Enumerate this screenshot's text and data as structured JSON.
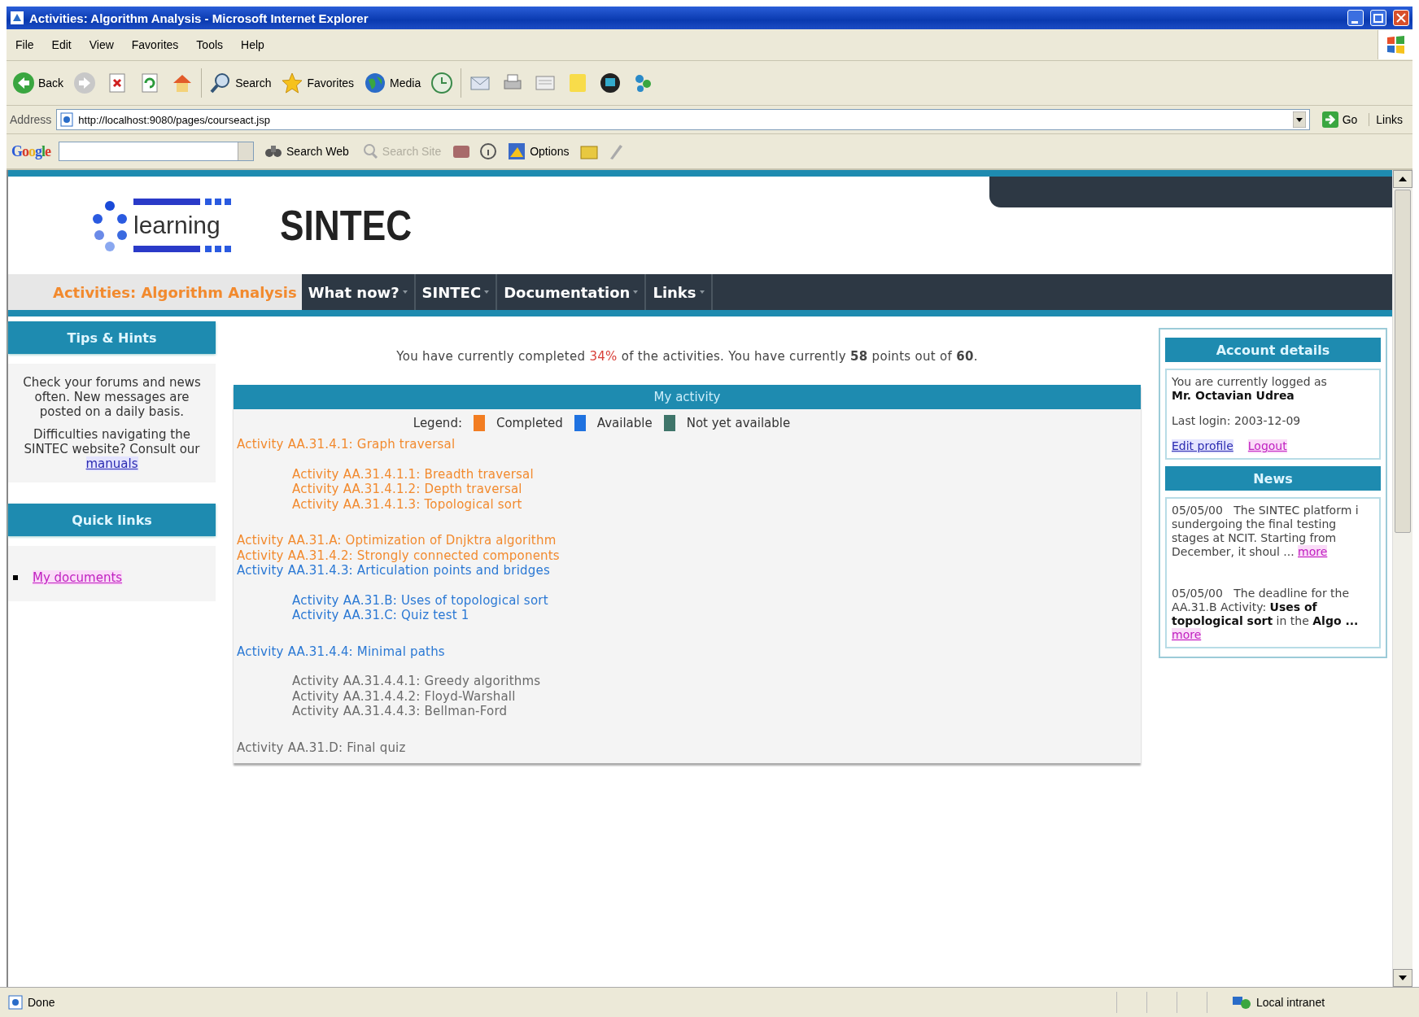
{
  "window": {
    "title": "Activities: Algorithm Analysis - Microsoft Internet Explorer"
  },
  "menu": [
    "File",
    "Edit",
    "View",
    "Favorites",
    "Tools",
    "Help"
  ],
  "toolbar": [
    {
      "kind": "back",
      "label": "Back"
    },
    {
      "kind": "forward"
    },
    {
      "kind": "stop"
    },
    {
      "kind": "refresh"
    },
    {
      "kind": "home"
    },
    {
      "kind": "search",
      "label": "Search"
    },
    {
      "kind": "favorites",
      "label": "Favorites"
    },
    {
      "kind": "media",
      "label": "Media"
    },
    {
      "kind": "history"
    },
    {
      "kind": "mail"
    },
    {
      "kind": "print"
    },
    {
      "kind": "edit"
    },
    {
      "kind": "note"
    },
    {
      "kind": "messenger"
    },
    {
      "kind": "people"
    }
  ],
  "address": {
    "label": "Address",
    "value": "http://localhost:9080/pages/courseact.jsp",
    "go": "Go",
    "links": "Links"
  },
  "google_bar": {
    "logo": "Google",
    "search_web": "Search Web",
    "search_site": "Search Site",
    "options": "Options"
  },
  "site": {
    "logo_text": "learning",
    "title": "SINTEC"
  },
  "nav": {
    "page_title": "Activities: Algorithm Analysis",
    "items": [
      "What now?",
      "SINTEC",
      "Documentation",
      "Links"
    ]
  },
  "tips": {
    "title": "Tips & Hints",
    "paragraphs": [
      {
        "text": "Check your forums and news often. New messages are posted on a daily basis."
      },
      {
        "text": "Difficulties navigating the SINTEC website? Consult our ",
        "link": "manuals"
      }
    ]
  },
  "quick_links": {
    "title": "Quick links",
    "items": [
      {
        "label": "My documents",
        "visited": true
      }
    ]
  },
  "summary": {
    "before": "You have currently completed ",
    "percent": "34%",
    "after": " of the activities. You have currently **58** points out of **60**."
  },
  "activity": {
    "title": "My activity",
    "legend_label": "Legend:",
    "legend": [
      {
        "label": "Completed",
        "color": "#f27d22"
      },
      {
        "label": "Available",
        "color": "#1f72e0"
      },
      {
        "label": "Not yet available",
        "color": "#3f756a"
      }
    ],
    "items": [
      {
        "label": "Activity AA.31.4.1: Graph traversal",
        "color": "#f28a2e",
        "children": [
          {
            "label": "Activity AA.31.4.1.1: Breadth traversal",
            "color": "#f28a2e"
          },
          {
            "label": "Activity AA.31.4.1.2: Depth traversal",
            "color": "#f28a2e"
          },
          {
            "label": "Activity AA.31.4.1.3: Topological sort",
            "color": "#f28a2e"
          }
        ]
      },
      {
        "label": "Activity AA.31.A: Optimization of Dnjktra algorithm",
        "color": "#f28a2e"
      },
      {
        "label": "Activity AA.31.4.2: Strongly connected components",
        "color": "#f28a2e"
      },
      {
        "label": "Activity AA.31.4.3: Articulation points and bridges",
        "color": "#2a78d4",
        "children": [
          {
            "label": "Activity AA.31.B: Uses of topological sort",
            "color": "#2a78d4"
          },
          {
            "label": "Activity AA.31.C: Quiz test 1",
            "color": "#2a78d4"
          }
        ]
      },
      {
        "label": "Activity AA.31.4.4: Minimal paths",
        "color": "#2a78d4",
        "children": [
          {
            "label": "Activity AA.31.4.4.1: Greedy algorithms",
            "color": "#6a6a6a"
          },
          {
            "label": "Activity AA.31.4.4.2: Floyd-Warshall",
            "color": "#6a6a6a"
          },
          {
            "label": "Activity AA.31.4.4.3: Bellman-Ford",
            "color": "#6a6a6a"
          }
        ]
      },
      {
        "label": "Activity AA.31.D: Final quiz",
        "color": "#6a6a6a"
      }
    ]
  },
  "account": {
    "title": "Account details",
    "logged_as": "You are currently logged as",
    "user": "Mr. Octavian Udrea",
    "last_login": "Last login: 2003-12-09",
    "links": [
      {
        "label": "Edit profile",
        "visited": false
      },
      {
        "label": "Logout",
        "visited": true
      }
    ]
  },
  "news": {
    "title": "News",
    "items": [
      {
        "date": "05/05/00",
        "text": "The SINTEC platform i sundergoing the final testing stages at NCIT. Starting from December, it shoul ...",
        "more": {
          "label": "more",
          "visited": true
        }
      },
      {
        "date": "05/05/00",
        "text": "The deadline for the AA.31.B Activity: **Uses of topological sort** in the **Algo ...**",
        "more": {
          "label": "more",
          "visited": true
        }
      }
    ]
  },
  "status_bar": {
    "text": "Done",
    "zone": "Local intranet"
  }
}
